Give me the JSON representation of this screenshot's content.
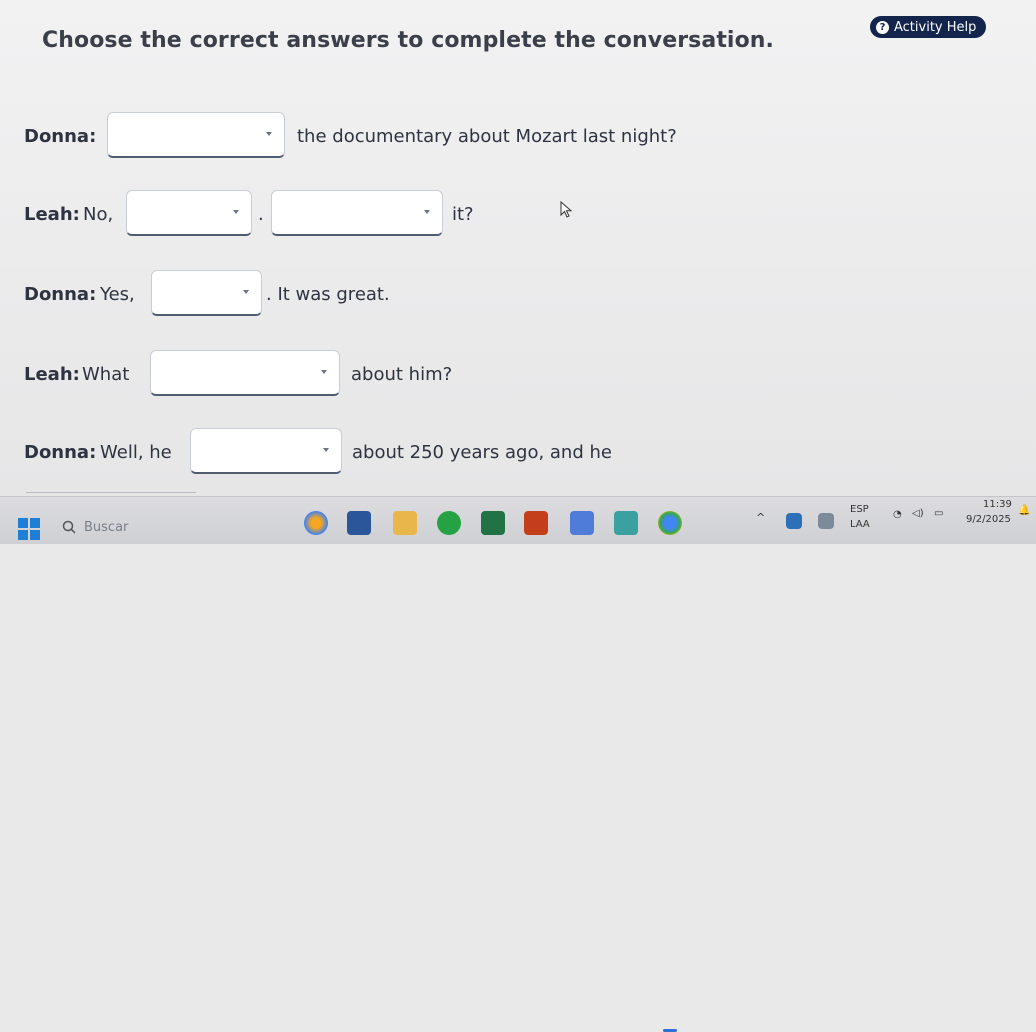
{
  "header": {
    "title": "Choose the correct answers to complete the conversation.",
    "help_label": "Activity Help",
    "help_icon": "question-circle-icon"
  },
  "conversation": {
    "line1": {
      "speaker": "Donna:",
      "after": "the documentary about Mozart last night?"
    },
    "line2": {
      "speaker": "Leah:",
      "intro": "No,",
      "mid": ".",
      "after": "it?"
    },
    "line3": {
      "speaker": "Donna:",
      "intro": "Yes,",
      "after": ". It was great."
    },
    "line4": {
      "speaker": "Leah:",
      "intro": "What",
      "after": "about him?"
    },
    "line5": {
      "speaker": "Donna:",
      "intro": "Well, he",
      "after": "about 250 years ago, and he"
    }
  },
  "taskbar": {
    "search_placeholder": "Buscar",
    "lang_primary": "ESP",
    "lang_secondary": "LAA",
    "time": "11:39",
    "date": "9/2/2025"
  },
  "colors": {
    "help_bg": "#13254d",
    "dropdown_underline": "#4f5c72",
    "windows_blue": "#1f7fd4"
  }
}
